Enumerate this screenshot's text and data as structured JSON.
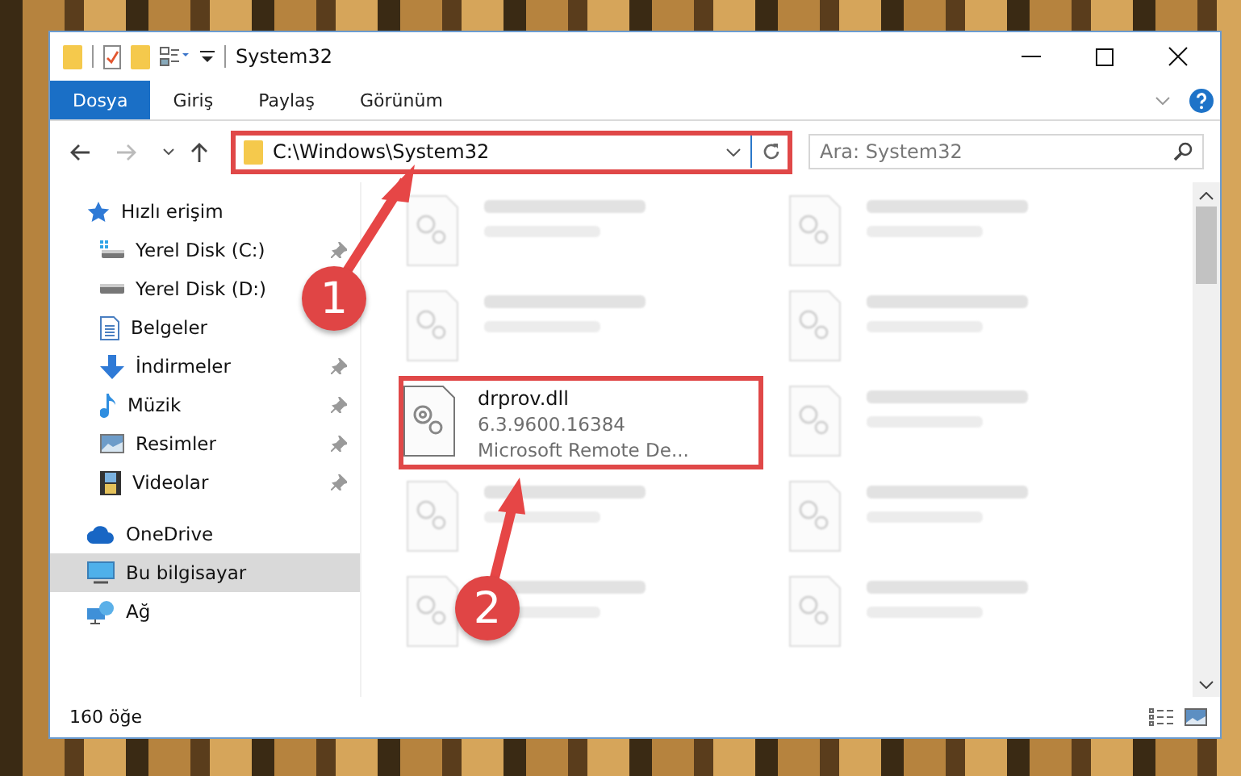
{
  "window": {
    "title": "System32"
  },
  "ribbon_tabs": [
    {
      "label": "Dosya",
      "selected": true
    },
    {
      "label": "Giriş",
      "selected": false
    },
    {
      "label": "Paylaş",
      "selected": false
    },
    {
      "label": "Görünüm",
      "selected": false
    }
  ],
  "address_bar": {
    "path": "C:\\Windows\\System32",
    "highlighted": true
  },
  "search": {
    "placeholder": "Ara: System32"
  },
  "sidebar": {
    "items": [
      {
        "label": "Hızlı erişim",
        "kind": "star",
        "selected": false,
        "children": [
          {
            "label": "Yerel Disk (C:)",
            "kind": "drive-c",
            "pinned": true
          },
          {
            "label": "Yerel Disk (D:)",
            "kind": "drive",
            "pinned": false
          },
          {
            "label": "Belgeler",
            "kind": "documents",
            "pinned": false
          },
          {
            "label": "İndirmeler",
            "kind": "downloads",
            "pinned": true
          },
          {
            "label": "Müzik",
            "kind": "music",
            "pinned": true
          },
          {
            "label": "Resimler",
            "kind": "pictures",
            "pinned": true
          },
          {
            "label": "Videolar",
            "kind": "videos",
            "pinned": true
          }
        ]
      },
      {
        "label": "OneDrive",
        "kind": "cloud",
        "selected": false
      },
      {
        "label": "Bu bilgisayar",
        "kind": "computer",
        "selected": true
      },
      {
        "label": "Ağ",
        "kind": "network",
        "selected": false
      }
    ]
  },
  "files": [
    {
      "blurred": true
    },
    {
      "blurred": true
    },
    {
      "blurred": true
    },
    {
      "blurred": true
    },
    {
      "name": "drprov.dll",
      "lines": [
        "6.3.9600.16384",
        "Microsoft Remote De..."
      ],
      "blurred": false,
      "highlighted": true
    },
    {
      "blurred": true
    },
    {
      "blurred": true
    },
    {
      "blurred": true
    },
    {
      "blurred": true
    },
    {
      "blurred": true
    }
  ],
  "status_bar": {
    "count": "160 öğe"
  },
  "annotations": [
    {
      "label": "1"
    },
    {
      "label": "2"
    }
  ]
}
